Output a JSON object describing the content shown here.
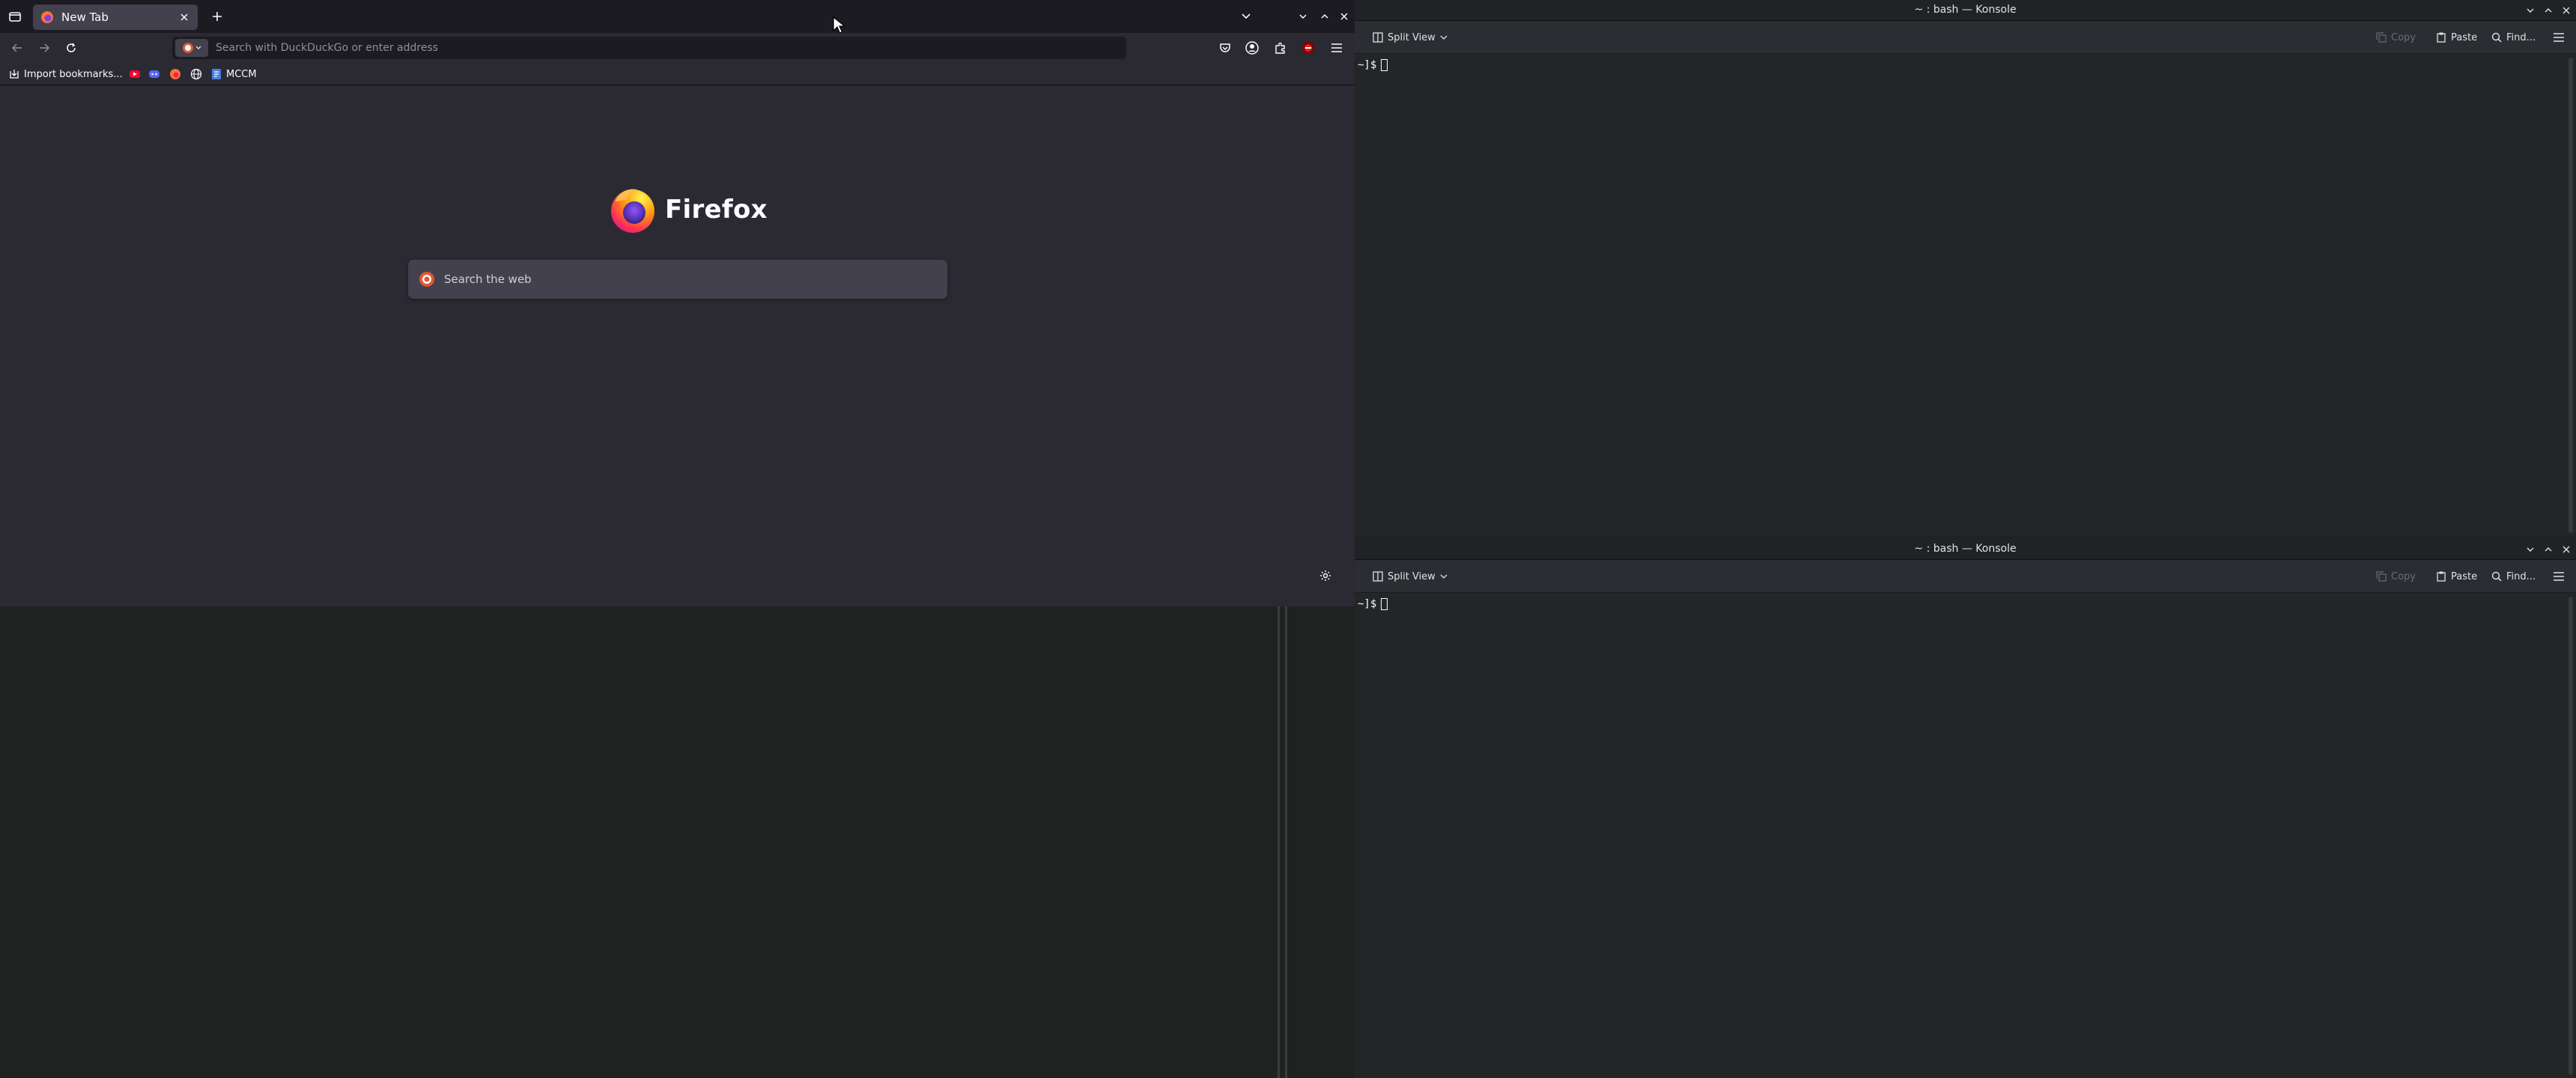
{
  "firefox": {
    "tab": {
      "title": "New Tab"
    },
    "urlbar": {
      "placeholder": "Search with DuckDuckGo or enter address"
    },
    "bookmarks": [
      {
        "label": "Import bookmarks...",
        "icon": "import-icon"
      },
      {
        "label": "",
        "icon": "youtube-icon"
      },
      {
        "label": "",
        "icon": "discord-icon"
      },
      {
        "label": "",
        "icon": "firefox-icon"
      },
      {
        "label": "",
        "icon": "globe-icon"
      },
      {
        "label": "MCCM",
        "icon": "document-icon"
      }
    ],
    "newtab": {
      "wordmark": "Firefox",
      "search_placeholder": "Search the web"
    },
    "colors": {
      "chrome": "#1c1b22",
      "content": "#2b2a33",
      "accent": "#ff7139"
    }
  },
  "konsole_top": {
    "title": "~ : bash — Konsole",
    "toolbar": {
      "split_view": "Split View",
      "copy": "Copy",
      "paste": "Paste",
      "find": "Find..."
    },
    "prompt": "~]$"
  },
  "konsole_bottom": {
    "title": "~ : bash — Konsole",
    "toolbar": {
      "split_view": "Split View",
      "copy": "Copy",
      "paste": "Paste",
      "find": "Find..."
    },
    "prompt": "~]$"
  }
}
